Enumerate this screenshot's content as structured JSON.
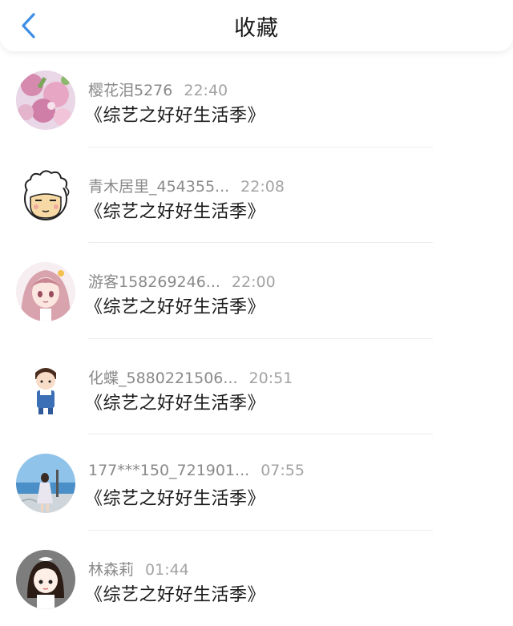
{
  "header": {
    "title": "收藏",
    "back_icon": "chevron-left-icon",
    "accent": "#3e8ee6"
  },
  "items": [
    {
      "username": "樱花泪5276",
      "time": "22:40",
      "title": "《综艺之好好生活季》",
      "avatar": "cherry-blossom-avatar"
    },
    {
      "username": "青木居里_454355...",
      "time": "22:08",
      "title": "《综艺之好好生活季》",
      "avatar": "cartoon-sheep-avatar"
    },
    {
      "username": "游客158269246...",
      "time": "22:00",
      "title": "《综艺之好好生活季》",
      "avatar": "anime-girl-avatar"
    },
    {
      "username": "化蝶_5880221506...",
      "time": "20:51",
      "title": "《综艺之好好生活季》",
      "avatar": "cartoon-boy-avatar"
    },
    {
      "username": "177***150_721901...",
      "time": "07:55",
      "title": "《综艺之好好生活季》",
      "avatar": "girl-by-sea-avatar"
    },
    {
      "username": "林森莉",
      "time": "01:44",
      "title": "《综艺之好好生活季》",
      "avatar": "cartoon-girl-avatar"
    }
  ]
}
